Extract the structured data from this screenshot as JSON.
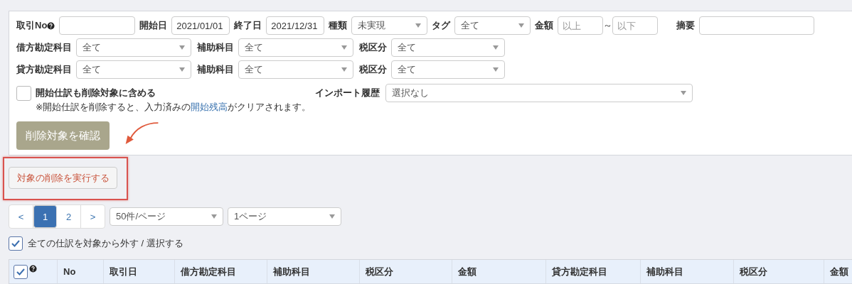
{
  "filters": {
    "row_1": [
      {
        "kind": "input",
        "label": "取引No",
        "help": true
      },
      {
        "kind": "input",
        "label": "開始日",
        "value": "2021/01/01"
      },
      {
        "kind": "input",
        "label": "終了日",
        "value": "2021/12/31"
      },
      {
        "kind": "select",
        "label": "種類",
        "value": "未実現"
      },
      {
        "kind": "select",
        "label": "タグ",
        "value": "全て"
      },
      {
        "kind": "range",
        "label": "金額",
        "placeholder_min": "以上",
        "separator": "～",
        "placeholder_max": "以下"
      },
      {
        "kind": "input",
        "label": "摘要"
      }
    ],
    "row_2": [
      {
        "kind": "select",
        "label": "借方勘定科目",
        "value": "全て"
      },
      {
        "kind": "select",
        "label": "補助科目",
        "value": "全て"
      },
      {
        "kind": "select",
        "label": "税区分",
        "value": "全て"
      }
    ],
    "row_3": [
      {
        "kind": "select",
        "label": "貸方勘定科目",
        "value": "全て"
      },
      {
        "kind": "select",
        "label": "補助科目",
        "value": "全て"
      },
      {
        "kind": "select",
        "label": "税区分",
        "value": "全て"
      }
    ],
    "include_opening": {
      "label": "開始仕訳も削除対象に含める",
      "checked": false
    },
    "import_history": {
      "label": "インポート履歴",
      "value": "選択なし"
    },
    "note": {
      "before": "※開始仕訳を削除すると、入力済みの",
      "link": "開始残高",
      "after": "がクリアされます。"
    },
    "confirm_button": "削除対象を確認"
  },
  "execute_button": "対象の削除を実行する",
  "pagination": {
    "pages": [
      {
        "label": "<",
        "selected": false
      },
      {
        "label": "1",
        "selected": true
      },
      {
        "label": "2",
        "selected": false
      },
      {
        "label": ">",
        "selected": false
      }
    ],
    "per_page": "50件/ページ",
    "page_select": "1ページ"
  },
  "select_all": {
    "label": "全ての仕訳を対象から外す / 選択する",
    "checked": true
  },
  "table": {
    "header_checkbox": {
      "checked": true,
      "help": true
    },
    "columns": [
      "No",
      "取引日",
      "借方勘定科目",
      "補助科目",
      "税区分",
      "金額",
      "貸方勘定科目",
      "補助科目",
      "税区分",
      "金額"
    ]
  }
}
